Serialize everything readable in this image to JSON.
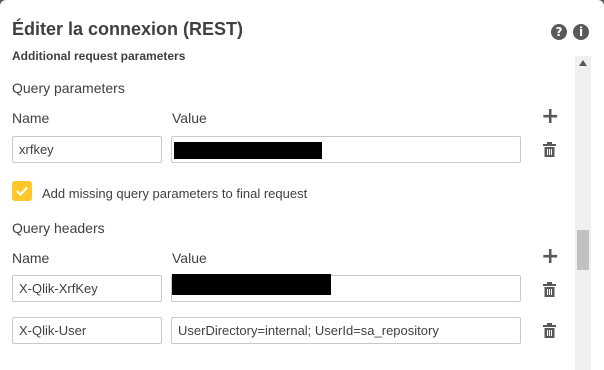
{
  "dialog": {
    "title": "Éditer la connexion (REST)"
  },
  "header_icons": {
    "help": "question-icon",
    "info": "info-icon"
  },
  "section_cut": "Additional request parameters",
  "query_parameters": {
    "title": "Query parameters",
    "name_label": "Name",
    "value_label": "Value",
    "rows": [
      {
        "name": "xrfkey",
        "value": ""
      }
    ]
  },
  "add_missing": {
    "checked": true,
    "label": "Add missing query parameters to final request"
  },
  "query_headers": {
    "title": "Query headers",
    "name_label": "Name",
    "value_label": "Value",
    "rows": [
      {
        "name": "X-Qlik-XrfKey",
        "value": ""
      },
      {
        "name": "X-Qlik-User",
        "value": "UserDirectory=internal; UserId=sa_repository"
      }
    ]
  },
  "colors": {
    "accent": "#ffc72a",
    "icon": "#595959",
    "border": "#c9c9c9"
  }
}
